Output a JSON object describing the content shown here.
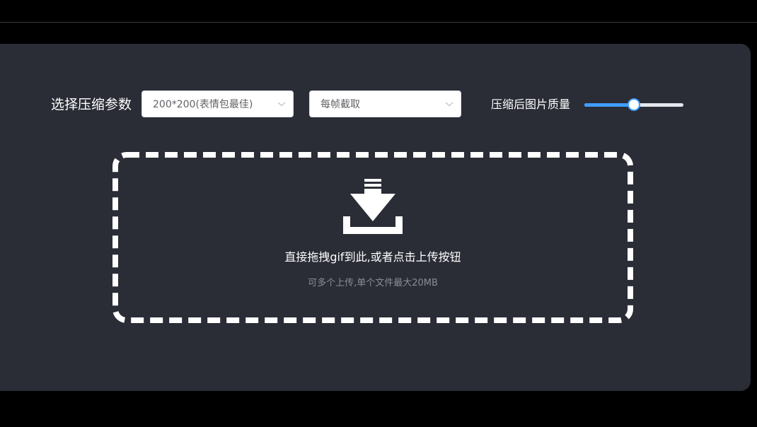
{
  "params": {
    "label": "选择压缩参数",
    "size_select": {
      "value": "200*200(表情包最佳)"
    },
    "frame_select": {
      "value": "每帧截取"
    }
  },
  "quality": {
    "label": "压缩后图片质量",
    "value_fraction": 0.5
  },
  "upload": {
    "icon": "download-tray-icon",
    "main_text": "直接拖拽gif到此,或者点击上传按钮",
    "sub_text": "可多个上传,单个文件最大20MB"
  },
  "colors": {
    "background": "#000000",
    "panel": "#2a2c36",
    "accent": "#409eff",
    "dashed_border": "#ffffff"
  }
}
